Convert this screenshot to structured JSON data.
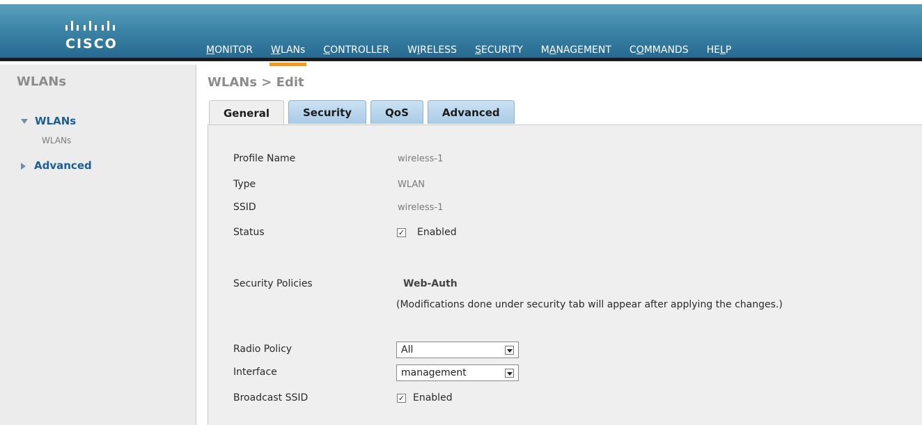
{
  "header": {
    "logo_text": "CISCO",
    "nav": [
      {
        "label": "MONITOR"
      },
      {
        "label": "WLANs"
      },
      {
        "label": "CONTROLLER"
      },
      {
        "label": "WIRELESS"
      },
      {
        "label": "SECURITY"
      },
      {
        "label": "MANAGEMENT"
      },
      {
        "label": "COMMANDS"
      },
      {
        "label": "HELP"
      }
    ],
    "active_nav": "WLANs",
    "accent_color": "#f29a1c"
  },
  "sidebar": {
    "title": "WLANs",
    "items": [
      {
        "label": "WLANs",
        "expanded": true,
        "children": [
          "WLANs"
        ]
      },
      {
        "label": "Advanced",
        "expanded": false
      }
    ]
  },
  "page": {
    "title": "WLANs > Edit",
    "tabs": [
      "General",
      "Security",
      "QoS",
      "Advanced"
    ],
    "active_tab": "General"
  },
  "form": {
    "profile_name_label": "Profile Name",
    "profile_name_value": "wireless-1",
    "type_label": "Type",
    "type_value": "WLAN",
    "ssid_label": "SSID",
    "ssid_value": "wireless-1",
    "status_label": "Status",
    "status_checkbox_label": "Enabled",
    "status_checked": true,
    "security_policies_label": "Security Policies",
    "security_policies_value": "Web-Auth",
    "security_note": "(Modifications done under security tab will appear after applying the changes.)",
    "radio_policy_label": "Radio Policy",
    "radio_policy_value": "All",
    "interface_label": "Interface",
    "interface_value": "management",
    "broadcast_ssid_label": "Broadcast SSID",
    "broadcast_ssid_checkbox_label": "Enabled",
    "broadcast_ssid_checked": true
  }
}
